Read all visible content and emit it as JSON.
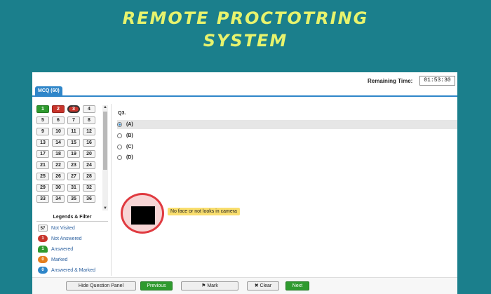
{
  "banner": {
    "line1": "REMOTE PROCTOTRING",
    "line2": "SYSTEM"
  },
  "header": {
    "remaining_label": "Remaining Time:",
    "remaining_value": "01:53:30"
  },
  "tab": {
    "label": "MCQ (60)"
  },
  "questions": [
    {
      "n": "1",
      "state": "answered"
    },
    {
      "n": "2",
      "state": "not-answered"
    },
    {
      "n": "3",
      "state": "current"
    },
    {
      "n": "4",
      "state": "not-visited"
    },
    {
      "n": "5",
      "state": "not-visited"
    },
    {
      "n": "6",
      "state": "not-visited"
    },
    {
      "n": "7",
      "state": "not-visited"
    },
    {
      "n": "8",
      "state": "not-visited"
    },
    {
      "n": "9",
      "state": "not-visited"
    },
    {
      "n": "10",
      "state": "not-visited"
    },
    {
      "n": "11",
      "state": "not-visited"
    },
    {
      "n": "12",
      "state": "not-visited"
    },
    {
      "n": "13",
      "state": "not-visited"
    },
    {
      "n": "14",
      "state": "not-visited"
    },
    {
      "n": "15",
      "state": "not-visited"
    },
    {
      "n": "16",
      "state": "not-visited"
    },
    {
      "n": "17",
      "state": "not-visited"
    },
    {
      "n": "18",
      "state": "not-visited"
    },
    {
      "n": "19",
      "state": "not-visited"
    },
    {
      "n": "20",
      "state": "not-visited"
    },
    {
      "n": "21",
      "state": "not-visited"
    },
    {
      "n": "22",
      "state": "not-visited"
    },
    {
      "n": "23",
      "state": "not-visited"
    },
    {
      "n": "24",
      "state": "not-visited"
    },
    {
      "n": "25",
      "state": "not-visited"
    },
    {
      "n": "26",
      "state": "not-visited"
    },
    {
      "n": "27",
      "state": "not-visited"
    },
    {
      "n": "28",
      "state": "not-visited"
    },
    {
      "n": "29",
      "state": "not-visited"
    },
    {
      "n": "30",
      "state": "not-visited"
    },
    {
      "n": "31",
      "state": "not-visited"
    },
    {
      "n": "32",
      "state": "not-visited"
    },
    {
      "n": "33",
      "state": "not-visited"
    },
    {
      "n": "34",
      "state": "not-visited"
    },
    {
      "n": "35",
      "state": "not-visited"
    },
    {
      "n": "36",
      "state": "not-visited"
    }
  ],
  "legend": {
    "title": "Legends & Filter",
    "items": [
      {
        "count": "57",
        "label": "Not Visited",
        "kind": "nv"
      },
      {
        "count": "1",
        "label": "Not Answered",
        "kind": "na"
      },
      {
        "count": "1",
        "label": "Answered",
        "kind": "an"
      },
      {
        "count": "0",
        "label": "Marked",
        "kind": "mk"
      },
      {
        "count": "0",
        "label": "Answered & Marked",
        "kind": "am"
      }
    ]
  },
  "question": {
    "number": "Q3.",
    "options": [
      {
        "label": "(A)",
        "selected": true
      },
      {
        "label": "(B)",
        "selected": false
      },
      {
        "label": "(C)",
        "selected": false
      },
      {
        "label": "(D)",
        "selected": false
      }
    ]
  },
  "camera": {
    "alert": "No face or not looks in camera"
  },
  "buttons": {
    "hide_panel": "Hide Question Panel",
    "previous": "Previous",
    "mark": "Mark",
    "clear": "Clear",
    "next": "Next"
  }
}
